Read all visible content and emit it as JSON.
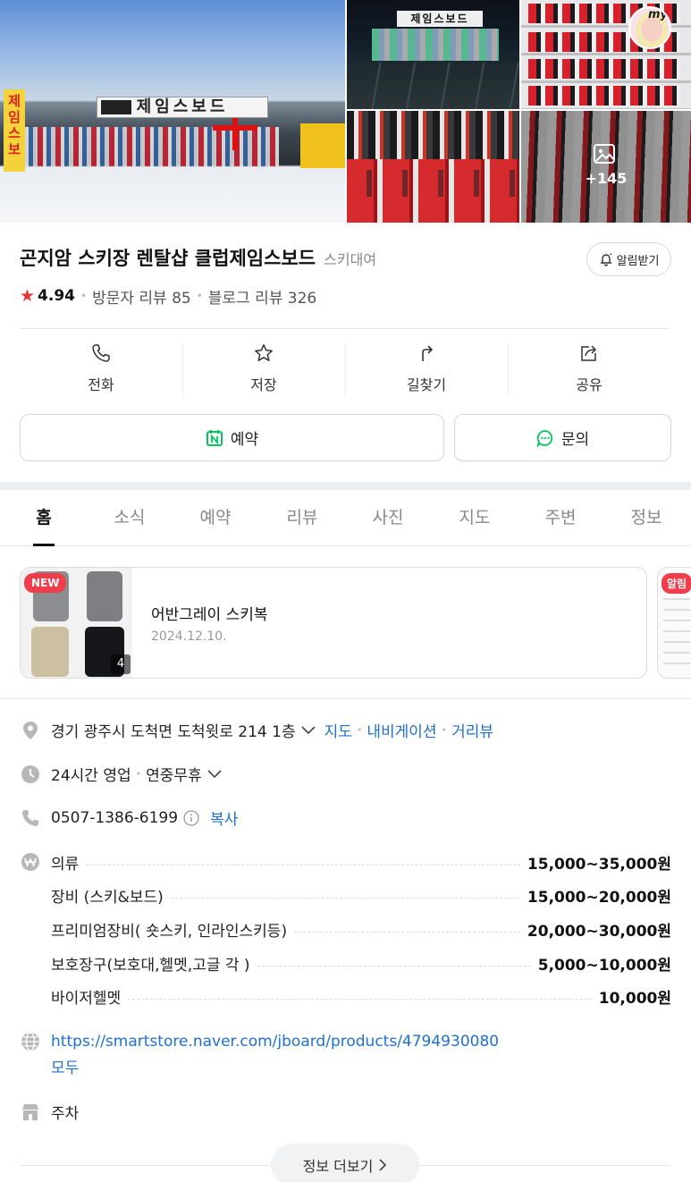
{
  "gallery": {
    "main_sign": "제임스보드",
    "night_sign": "제임스보드",
    "vertical_sign": "제임스보드",
    "more_count": "+145",
    "avatar_tag": "my"
  },
  "place": {
    "name": "곤지암 스키장 렌탈샵 클럽제임스보드",
    "category": "스키대여",
    "alert_label": "알림받기",
    "rating": "4.94",
    "visitor_reviews": "방문자 리뷰 85",
    "blog_reviews": "블로그 리뷰 326"
  },
  "actions": [
    {
      "label": "전화",
      "icon": "phone-icon"
    },
    {
      "label": "저장",
      "icon": "star-icon"
    },
    {
      "label": "길찾기",
      "icon": "directions-icon"
    },
    {
      "label": "공유",
      "icon": "share-icon"
    }
  ],
  "buttons": {
    "reserve": "예약",
    "inquiry": "문의"
  },
  "tabs": [
    "홈",
    "소식",
    "예약",
    "리뷰",
    "사진",
    "지도",
    "주변",
    "정보"
  ],
  "active_tab": "홈",
  "news": {
    "badge": "NEW",
    "title": "어반그레이 스키복",
    "date": "2024.12.10.",
    "photo_count": "4",
    "next_badge": "알림"
  },
  "info": {
    "address": "경기 광주시 도척면 도척윗로 214 1층",
    "address_links": [
      "지도",
      "내비게이션",
      "거리뷰"
    ],
    "hours": "24시간 영업",
    "hours_note": "연중무휴",
    "phone": "0507-1386-6199",
    "copy_label": "복사",
    "prices": [
      {
        "name": "의류",
        "value": "15,000~35,000원"
      },
      {
        "name": "장비 (스키&보드)",
        "value": "15,000~20,000원"
      },
      {
        "name": "프리미엄장비( 숏스키, 인라인스키등)",
        "value": "20,000~30,000원"
      },
      {
        "name": "보호장구(보호대,헬멧,고글 각 )",
        "value": "5,000~10,000원"
      },
      {
        "name": "바이저헬멧",
        "value": "10,000원"
      }
    ],
    "url": "https://smartstore.naver.com/jboard/products/4794930080",
    "url_tail": "모두",
    "parking": "주차"
  },
  "more_info": "정보 더보기",
  "colors": {
    "accent_link": "#1f6fd1",
    "rating_star": "#e53935",
    "naver_green": "#03c75a",
    "new_badge": "#ef3d4c"
  }
}
